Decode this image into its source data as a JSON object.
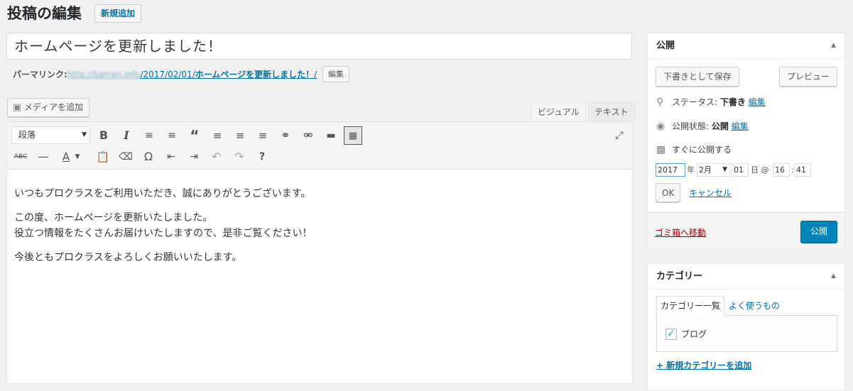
{
  "header": {
    "title": "投稿の編集",
    "add_new": "新規追加"
  },
  "post": {
    "title": "ホームページを更新しました！",
    "permalink_label": "パーマリンク:",
    "permalink_domain": "http://barran.info",
    "permalink_path": "/2017/02/01/",
    "permalink_slug": "ホームページを更新しました！",
    "permalink_trailing": "/",
    "permalink_edit": "編集"
  },
  "editor": {
    "media_button": "メディアを追加",
    "tab_visual": "ビジュアル",
    "tab_text": "テキスト",
    "format_select": "段落",
    "toolbar_row1": [
      "bold-icon",
      "italic-icon",
      "bullet-list-icon",
      "numbered-list-icon",
      "blockquote-icon",
      "align-left-icon",
      "align-center-icon",
      "align-right-icon",
      "link-icon",
      "unlink-icon",
      "read-more-icon",
      "toolbar-toggle-icon",
      "fullscreen-icon"
    ],
    "toolbar_row2": [
      "strikethrough-icon",
      "horizontal-line-icon",
      "text-color-icon",
      "paste-text-icon",
      "clear-format-icon",
      "special-char-icon",
      "outdent-icon",
      "indent-icon",
      "undo-icon",
      "redo-icon",
      "help-icon"
    ],
    "paragraphs": [
      [
        "いつもプロクラスをご利用いただき、誠にありがとうございます。"
      ],
      [
        "この度、ホームページを更新いたしました。",
        "役立つ情報をたくさんお届けいたしますので、是非ご覧ください！"
      ],
      [
        "今後ともプロクラスをよろしくお願いいたします。"
      ]
    ]
  },
  "publish": {
    "title": "公開",
    "save_draft": "下書きとして保存",
    "preview": "プレビュー",
    "status_label": "ステータス:",
    "status_value": "下書き",
    "status_edit": "編集",
    "visibility_label": "公開状態:",
    "visibility_value": "公開",
    "visibility_edit": "編集",
    "schedule_label": "すぐに公開する",
    "year": "2017",
    "year_suffix": "年",
    "month": "2月",
    "day": "01",
    "day_suffix": "日 @",
    "hour": "16",
    "minute": "41",
    "ok": "OK",
    "cancel": "キャンセル",
    "trash": "ゴミ箱へ移動",
    "publish_button": "公開"
  },
  "categories": {
    "title": "カテゴリー",
    "tab_all": "カテゴリー一覧",
    "tab_popular": "よく使うもの",
    "items": [
      {
        "label": "ブログ",
        "checked": true
      }
    ],
    "add_new": "+ 新規カテゴリーを追加"
  },
  "colors": {
    "link": "#0073aa",
    "primary": "#0085ba",
    "trash": "#a00000",
    "background": "#f1f1f1"
  }
}
